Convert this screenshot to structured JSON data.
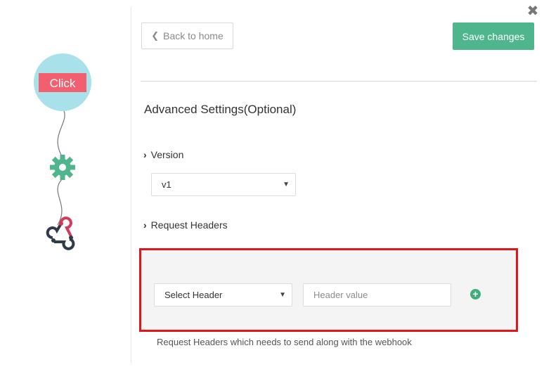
{
  "window": {
    "close_glyph": "✖",
    "close_icon": "close-icon"
  },
  "flow": {
    "trigger_label": "Click",
    "trigger_color": "#f25f6f",
    "trigger_bg": "#a8e1e9",
    "steps": [
      "trigger-click",
      "gear-icon",
      "webhook-icon"
    ]
  },
  "toolbar": {
    "back_chevron": "❮",
    "back_label": "Back to home",
    "save_label": "Save changes",
    "save_color": "#4fb58d"
  },
  "advanced": {
    "title": "Advanced Settings(Optional)",
    "version": {
      "label": "Version",
      "selected": "v1"
    },
    "headers": {
      "label": "Request Headers",
      "select_placeholder": "Select Header",
      "value_placeholder": "Header value",
      "add_glyph": "+",
      "help_text": "Request Headers which needs to send along with the webhook"
    }
  },
  "highlight_color": "#e0161b"
}
